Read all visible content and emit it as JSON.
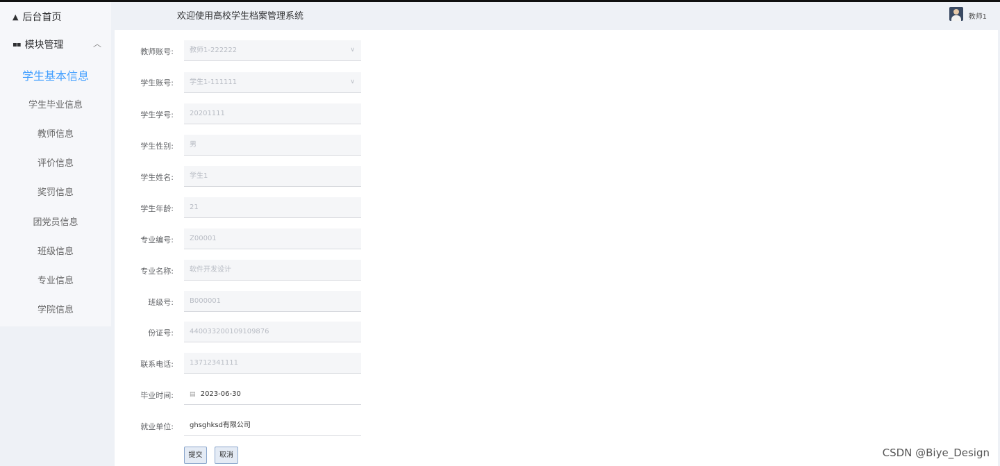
{
  "sidebar": {
    "home_icon": "home-icon",
    "home_label": "后台首页",
    "group_icon": "grid-icon",
    "group_label": "模块管理",
    "group_chevron": "︿",
    "items": [
      {
        "label": "学生基本信息",
        "active": true
      },
      {
        "label": "学生毕业信息"
      },
      {
        "label": "教师信息"
      },
      {
        "label": "评价信息"
      },
      {
        "label": "奖罚信息"
      },
      {
        "label": "团党员信息"
      },
      {
        "label": "班级信息"
      },
      {
        "label": "专业信息"
      },
      {
        "label": "学院信息"
      }
    ]
  },
  "header": {
    "welcome": "欢迎使用高校学生档案管理系统",
    "username": "教师1"
  },
  "form": {
    "fields": [
      {
        "label": "教师账号:",
        "value": "教师1-222222",
        "type": "select"
      },
      {
        "label": "学生账号:",
        "value": "学生1-111111",
        "type": "select"
      },
      {
        "label": "学生学号:",
        "value": "20201111"
      },
      {
        "label": "学生性别:",
        "value": "男"
      },
      {
        "label": "学生姓名:",
        "value": "学生1"
      },
      {
        "label": "学生年龄:",
        "value": "21"
      },
      {
        "label": "专业编号:",
        "value": "Z00001"
      },
      {
        "label": "专业名称:",
        "value": "软件开发设计"
      },
      {
        "label": "班级号:",
        "value": "B000001"
      },
      {
        "label": "份证号:",
        "value": "440033200109109876"
      },
      {
        "label": "联系电话:",
        "value": "13712341111"
      },
      {
        "label": "毕业时间:",
        "value": "2023-06-30",
        "type": "date"
      },
      {
        "label": "就业单位:",
        "value": "ghsghksd有限公司"
      }
    ],
    "submit_label": "提交",
    "cancel_label": "取消"
  },
  "watermark": "CSDN @Biye_Design"
}
